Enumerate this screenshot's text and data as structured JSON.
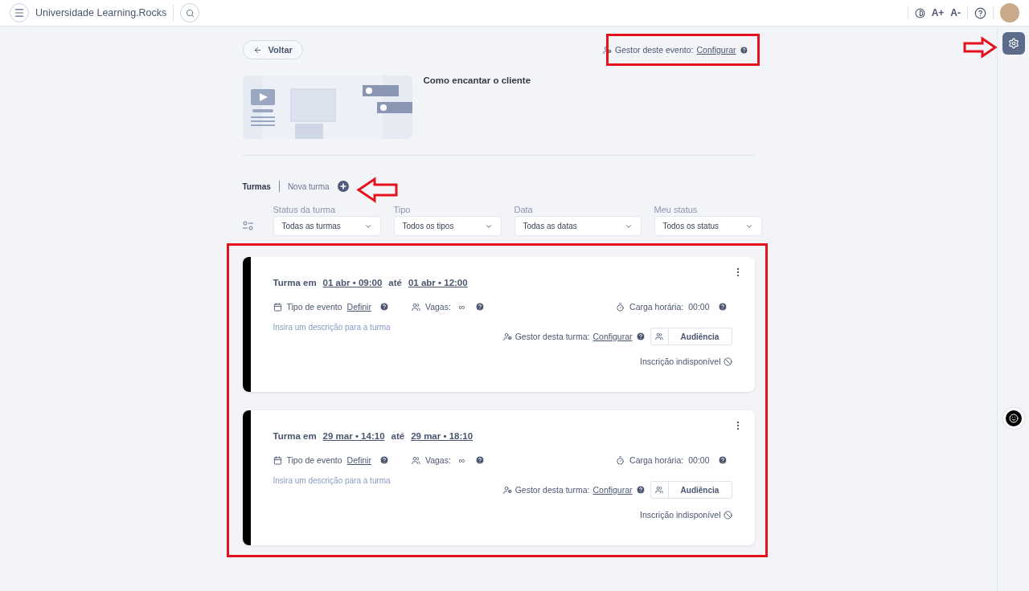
{
  "top_bar": {
    "title": "Universidade Learning.Rocks",
    "font_up": "A+",
    "font_down": "A-"
  },
  "back_button": "Voltar",
  "event_manager": {
    "label": "Gestor deste evento:",
    "link": "Configurar"
  },
  "event": {
    "title": "Como encantar o cliente"
  },
  "tabs": [
    {
      "label": "Turmas",
      "selected": true
    },
    {
      "label": "Nova turma",
      "selected": false
    }
  ],
  "filters": [
    {
      "label": "Status da turma",
      "value": "Todas as turmas"
    },
    {
      "label": "Tipo",
      "value": "Todos os tipos"
    },
    {
      "label": "Data",
      "value": "Todas as datas"
    },
    {
      "label": "Meu status",
      "value": "Todos os status"
    }
  ],
  "classes": [
    {
      "prefix": "Turma em",
      "start": "01 abr • 09:00",
      "connector": "até",
      "end": "01 abr • 12:00",
      "type_label": "Tipo de evento",
      "type_link": "Definir",
      "seats_label": "Vagas:",
      "seats_value": "∞",
      "workload_label": "Carga horária:",
      "workload_value": "00:00",
      "description": {
        "placeholder": "Insira um descrição para a turma"
      },
      "manager_label": "Gestor desta turma:",
      "manager_link": "Configurar",
      "audience_button": "Audiência",
      "enrollment_status": "Inscrição indisponível"
    },
    {
      "prefix": "Turma em",
      "start": "29 mar • 14:10",
      "connector": "até",
      "end": "29 mar • 18:10",
      "type_label": "Tipo de evento",
      "type_link": "Definir",
      "seats_label": "Vagas:",
      "seats_value": "∞",
      "workload_label": "Carga horária:",
      "workload_value": "00:00",
      "description": {
        "placeholder": "Insira um descrição para a turma"
      },
      "manager_label": "Gestor desta turma:",
      "manager_link": "Configurar",
      "audience_button": "Audiência",
      "enrollment_status": "Inscrição indisponível"
    }
  ]
}
